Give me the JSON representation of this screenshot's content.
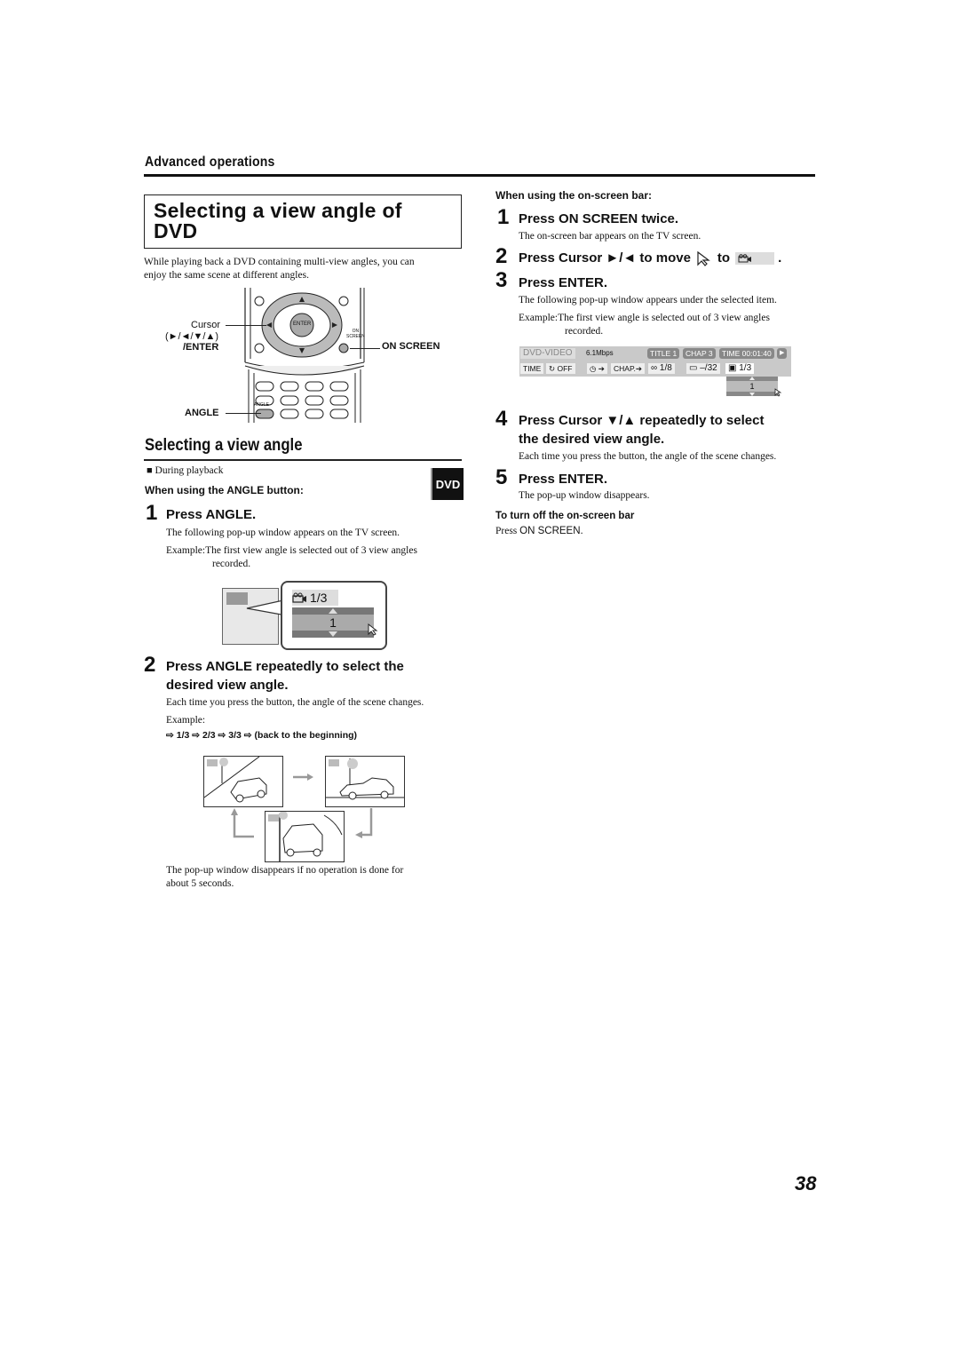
{
  "header": {
    "section": "Advanced operations"
  },
  "title": {
    "line1": "Selecting a view angle of",
    "line2": "DVD"
  },
  "intro": {
    "line1": "While playing back a DVD containing multi-view angles, you can",
    "line2": "enjoy the same scene at different angles."
  },
  "remote": {
    "cursor_label": "Cursor",
    "cursor_keys": "(►/◄/▼/▲)",
    "enter_label": "/ENTER",
    "on_screen_label": "ON SCREEN",
    "angle_label": "ANGLE",
    "enter_key": "ENTER",
    "on_key_1": "ON",
    "on_key_2": "SCREEN",
    "angle_key": "ANGLE"
  },
  "section2": {
    "heading": "Selecting a view angle",
    "condition_bullet": "■",
    "condition": "During playback",
    "badge": "DVD",
    "angle_button_head": "When using the ANGLE button:"
  },
  "left_steps": [
    {
      "num": "1",
      "title": "Press ANGLE.",
      "desc": "The following pop-up window appears on the TV screen.",
      "example_label": "Example:",
      "example_line1": "The first view angle is selected out of 3 view angles",
      "example_line2": "recorded."
    },
    {
      "num": "2",
      "title_line1": "Press ANGLE repeatedly to select the",
      "title_line2": "desired view angle.",
      "desc": "Each time you press the button, the angle of the scene changes.",
      "example_label": "Example:",
      "sequence": [
        "1/3",
        "2/3",
        "3/3",
        "(back to the beginning)"
      ],
      "sequence_arrow": "⇨"
    }
  ],
  "angle_popup": {
    "value": "1/3",
    "selected": "1"
  },
  "popup_note": {
    "line1": "The pop-up window disappears if no operation is done for",
    "line2": "about 5 seconds."
  },
  "onscreen": {
    "head": "When using the on-screen bar:",
    "steps": [
      {
        "num": "1",
        "title": "Press ON SCREEN twice.",
        "desc": "The on-screen bar appears on the TV screen."
      },
      {
        "num": "2",
        "title_a": "Press Cursor ►/◄ to move",
        "title_b": "to",
        "title_c": "."
      },
      {
        "num": "3",
        "title": "Press ENTER.",
        "desc": "The following pop-up window appears under the selected item.",
        "example_label": "Example:",
        "example_line1": "The first view angle is selected out of 3 view angles",
        "example_line2": "recorded."
      },
      {
        "num": "4",
        "title_line1": "Press Cursor ▼/▲ repeatedly to select",
        "title_line2": "the desired view angle.",
        "desc": "Each time you press the button, the angle of the scene changes."
      },
      {
        "num": "5",
        "title": "Press ENTER.",
        "desc": "The pop-up window disappears."
      }
    ],
    "turn_off_head": "To turn off the on-screen bar",
    "turn_off_prefix": "Press ",
    "turn_off_key": "ON SCREEN."
  },
  "osd": {
    "mode": "DVD-VIDEO",
    "bitrate": "6.1Mbps",
    "title": "TITLE  1",
    "chap": "CHAP  3",
    "time": "TIME 00:01:40",
    "play_icon": "▶",
    "time_btn": "TIME",
    "repeat": "OFF",
    "clock_arrow": "➔",
    "chap_btn": "CHAP.➔",
    "audio": "1/8",
    "subtitle": "–/32",
    "angle": "1/3",
    "popup_value": "1"
  },
  "page": {
    "number": "38"
  }
}
